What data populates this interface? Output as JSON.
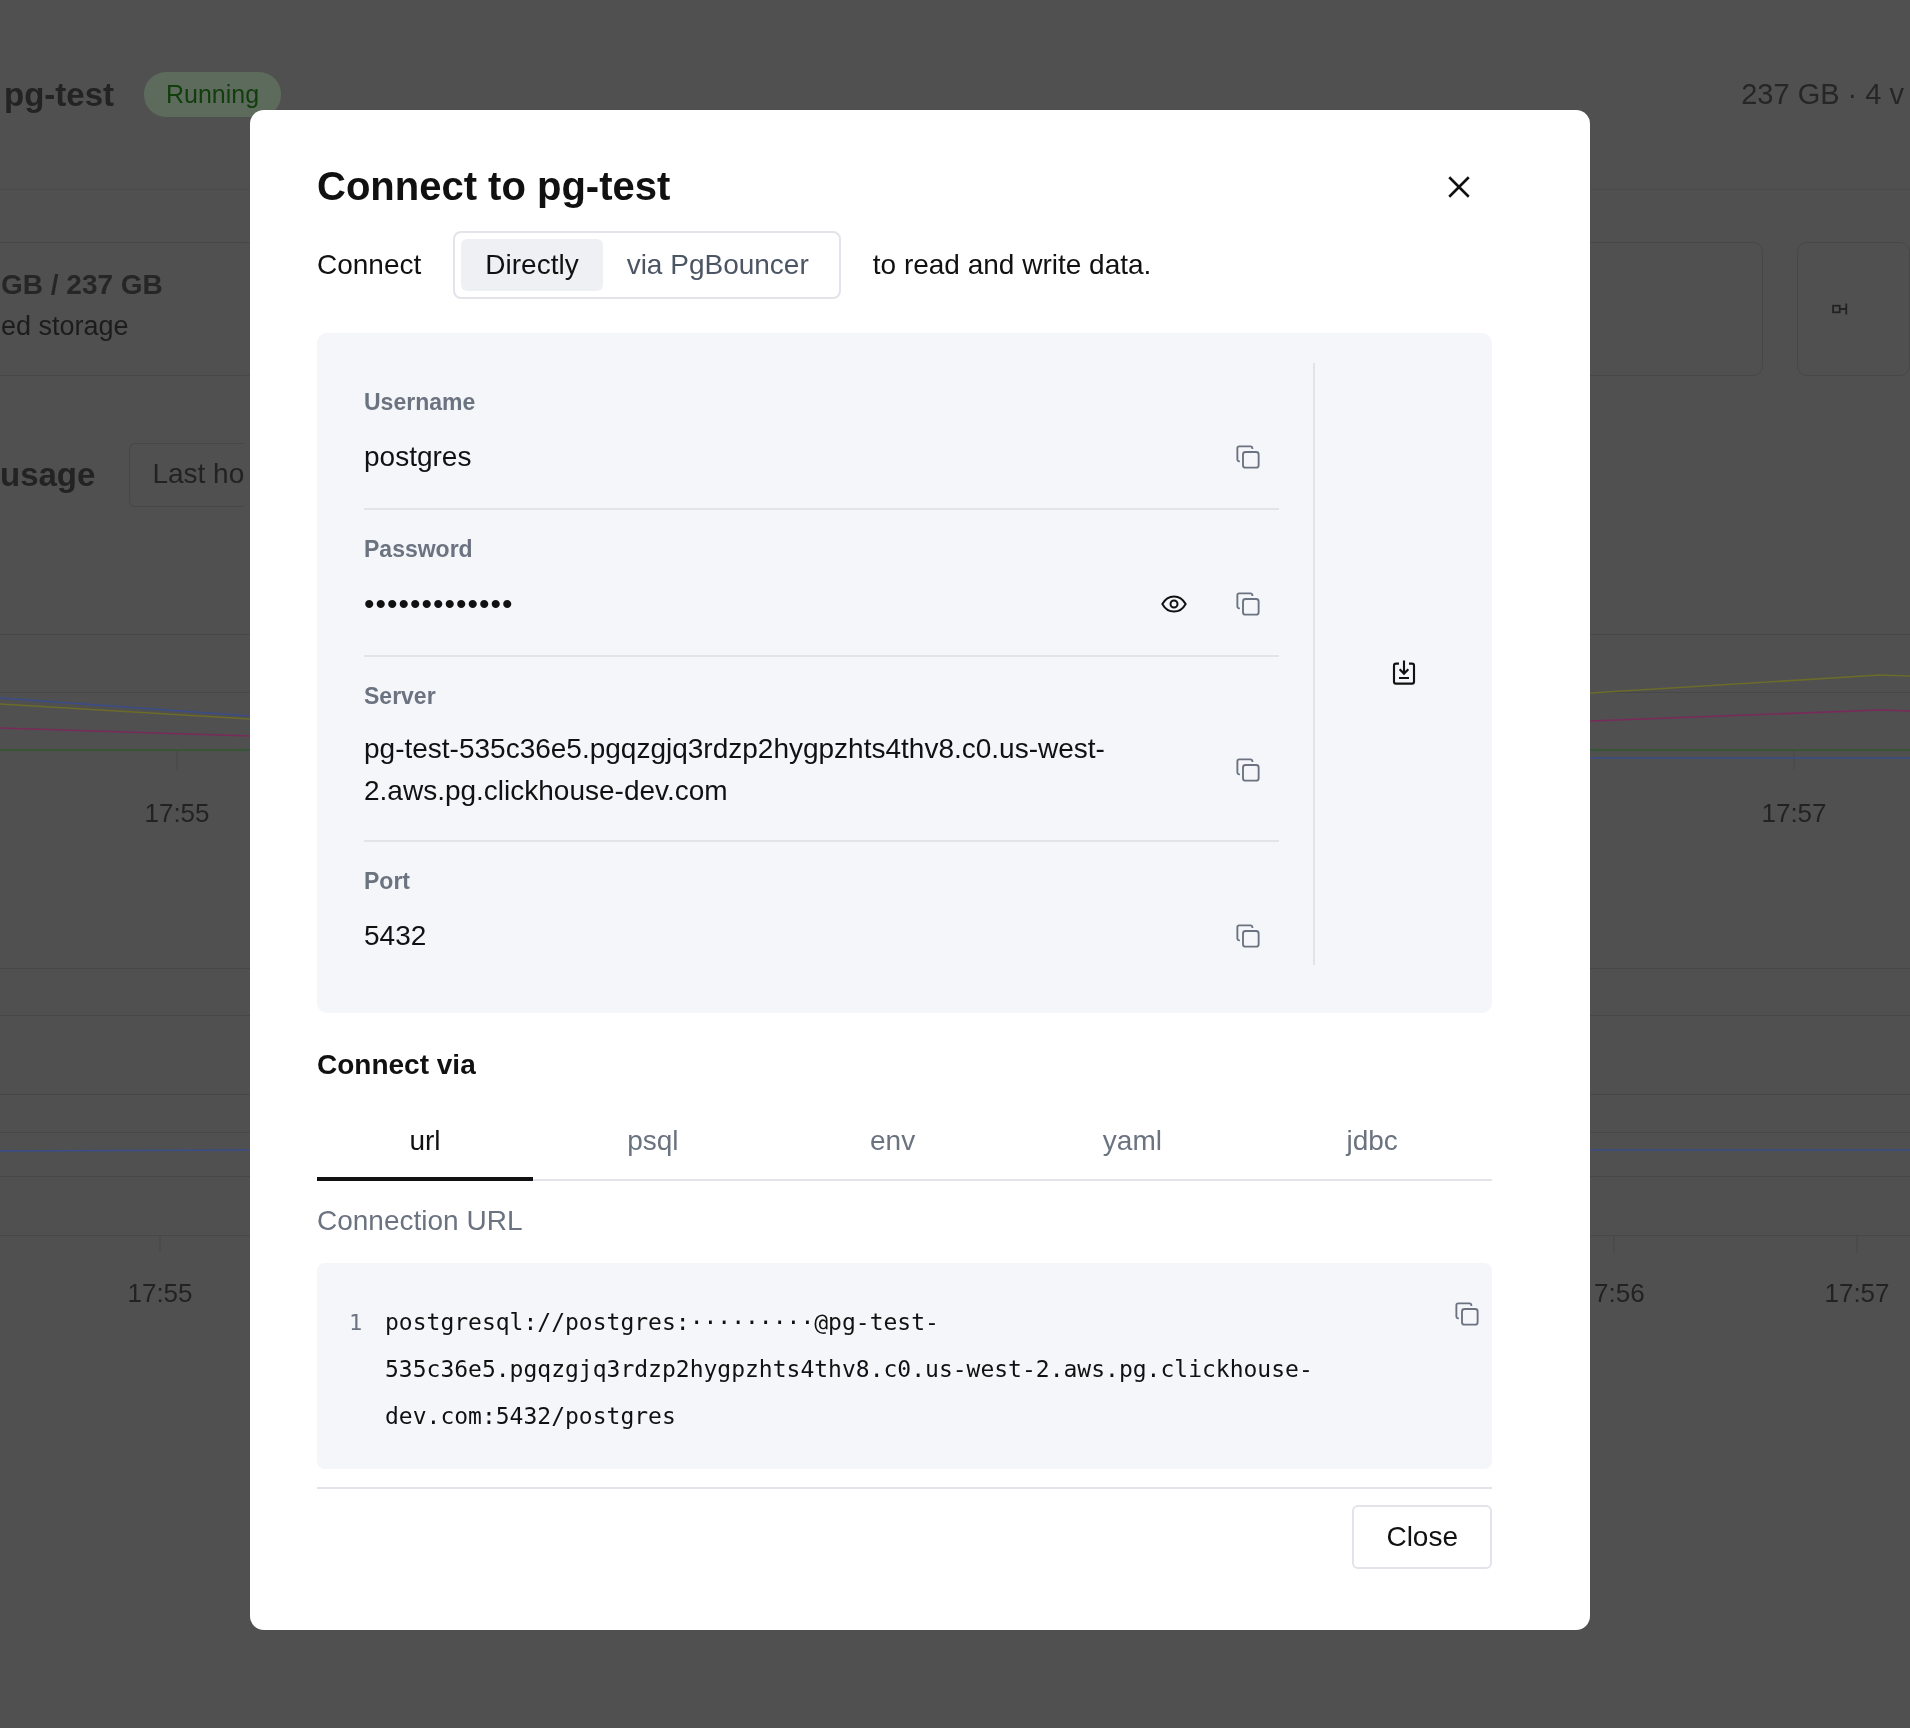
{
  "background": {
    "title": "pg-test",
    "status": "Running",
    "summary": "237 GB · 4 v",
    "storage_value": "GB / 237 GB",
    "storage_label": "ed storage",
    "usage_title": "usage",
    "range_select": "Last ho",
    "charts": [
      {
        "ticks": [
          "17:55",
          "17:57"
        ]
      },
      {
        "ticks": [
          "17:55",
          "7:56",
          "17:57"
        ]
      }
    ]
  },
  "dialog": {
    "title": "Connect to pg-test",
    "intro_prefix": "Connect",
    "modes": [
      {
        "label": "Directly",
        "selected": true
      },
      {
        "label": "via PgBouncer",
        "selected": false
      }
    ],
    "intro_suffix": "to read and write data.",
    "fields": [
      {
        "kind": "text",
        "label": "Username",
        "value": "postgres"
      },
      {
        "kind": "secret",
        "label": "Password",
        "value": "•••••••••••••"
      },
      {
        "kind": "text",
        "label": "Server",
        "value": "pg-test-535c36e5.pgqzgjq3rdzp2hygpzhts4thv8.c0.us-west-2.aws.pg.clickhouse-dev.com"
      },
      {
        "kind": "text",
        "label": "Port",
        "value": "5432"
      }
    ],
    "connect_via": "Connect via",
    "tabs": [
      {
        "label": "url",
        "selected": true
      },
      {
        "label": "psql",
        "selected": false
      },
      {
        "label": "env",
        "selected": false
      },
      {
        "label": "yaml",
        "selected": false
      },
      {
        "label": "jdbc",
        "selected": false
      }
    ],
    "snippet": {
      "label": "Connection URL",
      "line_number": "1",
      "code": "postgresql://postgres:·········@pg-test-535c36e5.pgqzgjq3rdzp2hygpzhts4thv8.c0.us-west-2.aws.pg.clickhouse-dev.com:5432/postgres"
    },
    "close_button": "Close"
  }
}
